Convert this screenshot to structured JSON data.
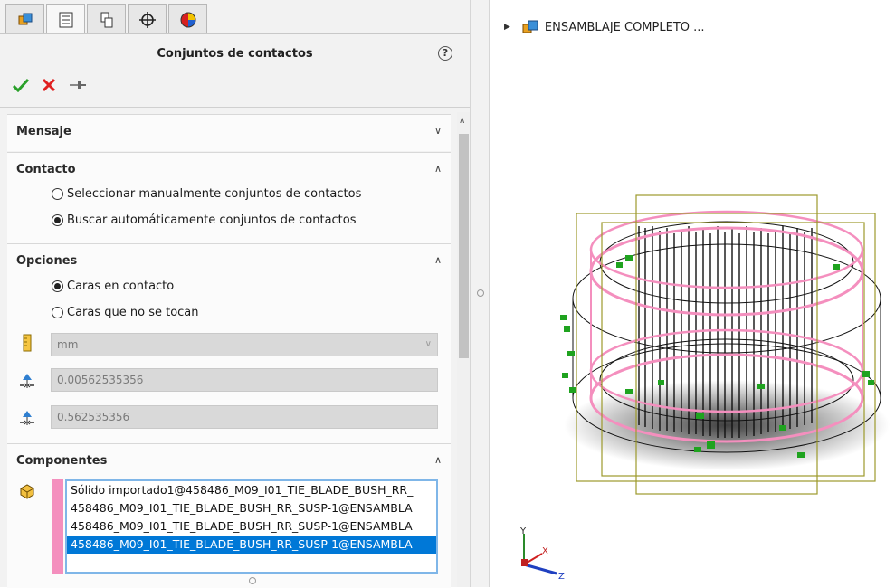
{
  "tabs": [
    {
      "name": "feature-manager-tab",
      "icon": "assembly-icon"
    },
    {
      "name": "property-manager-tab",
      "icon": "property-list-icon"
    },
    {
      "name": "configuration-manager-tab",
      "icon": "configuration-icon"
    },
    {
      "name": "dimxpert-tab",
      "icon": "crosshair-icon"
    },
    {
      "name": "display-manager-tab",
      "icon": "appearance-pie-icon"
    }
  ],
  "panel": {
    "title": "Conjuntos de contactos",
    "help": "?",
    "ok_icon": "checkmark-icon",
    "cancel_icon": "x-icon",
    "pin_icon": "pushpin-icon"
  },
  "groups": {
    "mensaje": {
      "title": "Mensaje"
    },
    "contacto": {
      "title": "Contacto",
      "options": [
        {
          "label": "Seleccionar manualmente conjuntos de contactos",
          "checked": false
        },
        {
          "label": "Buscar automáticamente conjuntos de contactos",
          "checked": true
        }
      ]
    },
    "opciones": {
      "title": "Opciones",
      "options": [
        {
          "label": "Caras en contacto",
          "checked": true
        },
        {
          "label": "Caras que no se tocan",
          "checked": false
        }
      ],
      "unit": "mm",
      "tolerance1": "0.00562535356",
      "tolerance2": "0.562535356"
    },
    "componentes": {
      "title": "Componentes",
      "items": [
        "Sólido importado1@458486_M09_I01_TIE_BLADE_BUSH_RR_",
        "458486_M09_I01_TIE_BLADE_BUSH_RR_SUSP-1@ENSAMBLA",
        "458486_M09_I01_TIE_BLADE_BUSH_RR_SUSP-1@ENSAMBLA",
        "458486_M09_I01_TIE_BLADE_BUSH_RR_SUSP-1@ENSAMBLA"
      ],
      "selected_index": 3
    }
  },
  "tree": {
    "label": "ENSAMBLAJE COMPLETO ...",
    "icon": "assembly-icon"
  },
  "triad": {
    "y": "Y",
    "x": "X",
    "z": "Z"
  },
  "colors": {
    "accent": "#0078d7",
    "ok": "#2aa02a",
    "cancel": "#e02020",
    "contact_pink": "#f48fbe",
    "bbox": "#9c9a2c",
    "marker_green": "#1fa31f"
  }
}
